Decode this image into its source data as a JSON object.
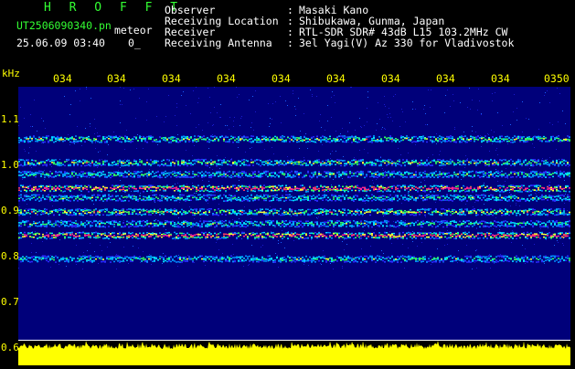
{
  "header": {
    "title": "H R O F F T",
    "filename": "UT2506090340.pn",
    "meteor_label": "meteor",
    "datetime": "25.06.09 03:40",
    "count": "0_",
    "info": [
      {
        "label": "Observer",
        "value": "Masaki Kano"
      },
      {
        "label": "Receiving Location",
        "value": "Shibukawa, Gunma, Japan"
      },
      {
        "label": "Receiver",
        "value": "RTL-SDR SDR# 43dB L15 103.2MHz CW"
      },
      {
        "label": "Receiving Antenna",
        "value": "3el Yagi(V) Az 330 for Vladivostok"
      }
    ],
    "colon": ":"
  },
  "axes": {
    "y_unit": "kHz",
    "y_ticks": [
      "1.1",
      "1.0",
      "0.9",
      "0.8",
      "0.7",
      "0.6"
    ],
    "x_ticks": [
      "034",
      "034",
      "034",
      "034",
      "034",
      "034",
      "034",
      "034",
      "034",
      "0350"
    ]
  },
  "colors": {
    "background": "#000000",
    "plot_background": "#00007a",
    "header_green": "#33ff33",
    "header_white": "#ffffff",
    "axis_yellow": "#ffff00",
    "power_yellow": "#ffff00"
  },
  "spectrogram": {
    "y_range_khz": [
      0.6,
      1.14
    ],
    "bands": [
      {
        "freq_khz": 1.03,
        "intensity": 0.55
      },
      {
        "freq_khz": 0.98,
        "intensity": 0.55
      },
      {
        "freq_khz": 0.955,
        "intensity": 0.45
      },
      {
        "freq_khz": 0.925,
        "intensity": 1.0
      },
      {
        "freq_khz": 0.905,
        "intensity": 0.45
      },
      {
        "freq_khz": 0.875,
        "intensity": 0.65
      },
      {
        "freq_khz": 0.85,
        "intensity": 0.45
      },
      {
        "freq_khz": 0.825,
        "intensity": 0.95
      },
      {
        "freq_khz": 0.775,
        "intensity": 0.45
      }
    ]
  }
}
